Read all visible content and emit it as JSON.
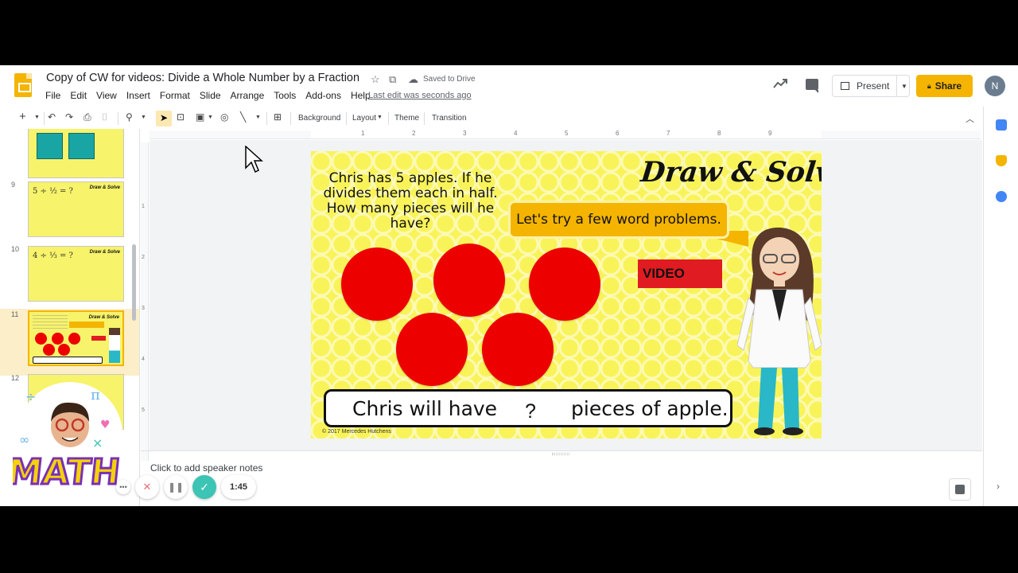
{
  "app": {
    "doc_title": "Copy of CW for videos: Divide a Whole Number by a Fraction",
    "saved_status": "Saved to Drive",
    "last_edit": "Last edit was seconds ago",
    "menu": [
      "File",
      "Edit",
      "View",
      "Insert",
      "Format",
      "Slide",
      "Arrange",
      "Tools",
      "Add-ons",
      "Help"
    ],
    "present_label": "Present",
    "share_label": "Share",
    "avatar_initial": "N",
    "brand_color": "#f4b400"
  },
  "toolbar": {
    "background_label": "Background",
    "layout_label": "Layout",
    "theme_label": "Theme",
    "transition_label": "Transition"
  },
  "ruler": {
    "h_ticks": [
      "1",
      "2",
      "3",
      "4",
      "5",
      "6",
      "7",
      "8",
      "9"
    ],
    "v_ticks": [
      "1",
      "2",
      "3",
      "4",
      "5"
    ]
  },
  "filmstrip": {
    "slides": [
      {
        "num": "9",
        "math": "5 ÷ ½ = ?",
        "tag": "Draw & Solve"
      },
      {
        "num": "10",
        "math": "4 ÷ ⅓ = ?",
        "tag": "Draw & Solve"
      },
      {
        "num": "11",
        "tag": "Draw & Solve",
        "active": true
      },
      {
        "num": "12"
      }
    ]
  },
  "slide": {
    "title": "Draw & Solve",
    "word_problem": "Chris has 5 apples.  If he divides them each in half.  How many pieces will he have?",
    "bubble_text": "Let's try a few word problems.",
    "video_label": "VIDEO",
    "answer_left": "Chris will have",
    "answer_blank": "?",
    "answer_right": "pieces of apple.",
    "copyright": "© 2017 Mercedes Hutchens",
    "apple_count": 5,
    "apple_color": "#ec0000"
  },
  "notes": {
    "placeholder": "Click to add speaker notes"
  },
  "recorder": {
    "sticker_text": "MATH",
    "timer": "1:45"
  }
}
